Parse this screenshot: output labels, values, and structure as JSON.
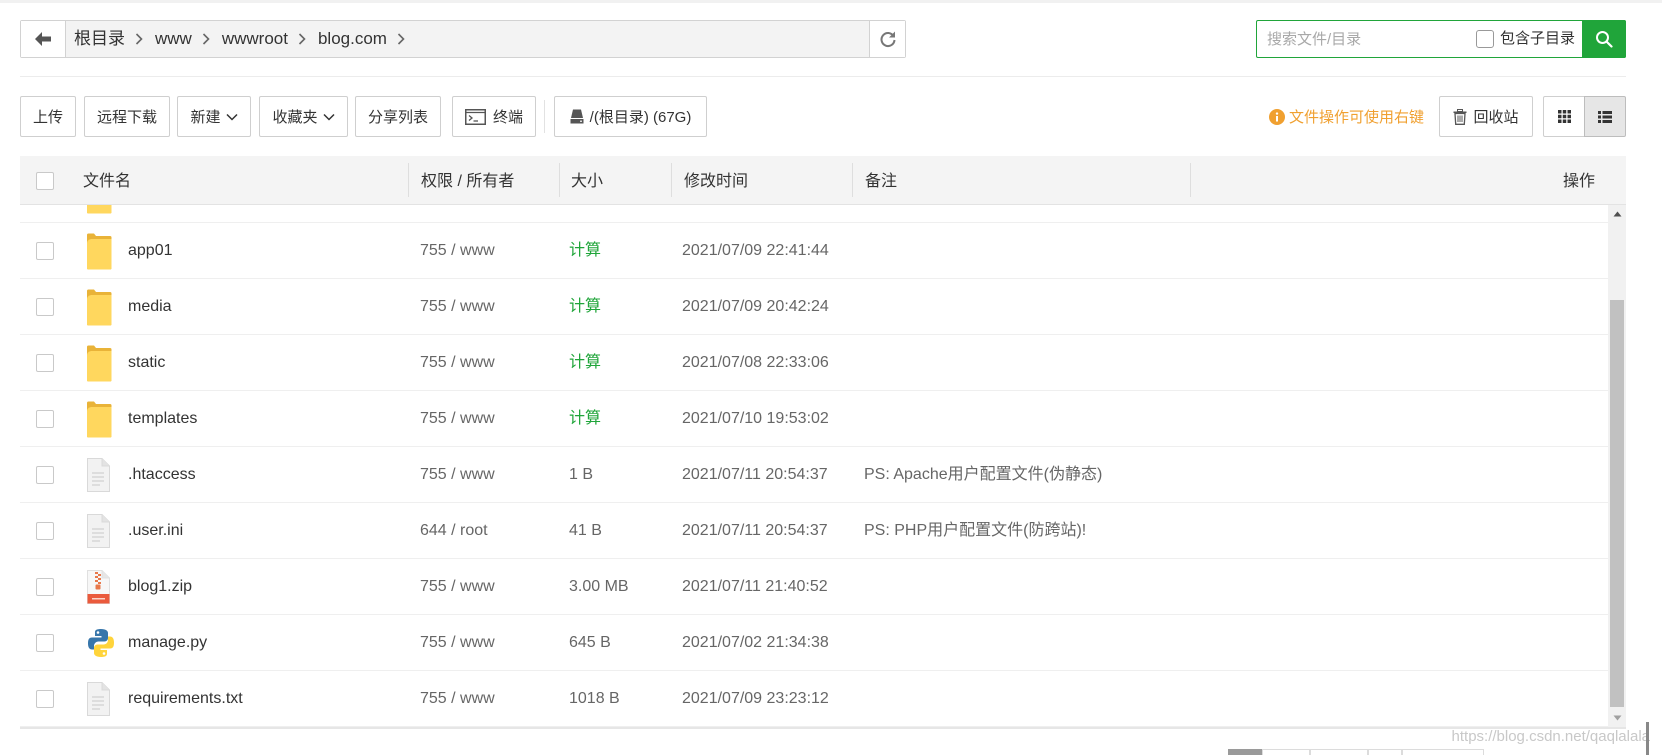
{
  "breadcrumb": {
    "items": [
      "根目录",
      "www",
      "wwwroot",
      "blog.com"
    ]
  },
  "search": {
    "placeholder": "搜索文件/目录",
    "include_subdir": "包含子目录"
  },
  "toolbar": {
    "upload": "上传",
    "remote_download": "远程下载",
    "new": "新建",
    "favorites": "收藏夹",
    "share_list": "分享列表",
    "terminal": "终端",
    "disk": "/(根目录) (67G)",
    "hint": "文件操作可使用右键",
    "recycle_bin": "回收站"
  },
  "table": {
    "headers": {
      "name": "文件名",
      "perm": "权限 / 所有者",
      "size": "大小",
      "mtime": "修改时间",
      "note": "备注",
      "actions": "操作"
    },
    "rows": [
      {
        "icon": "folder-icon",
        "name": "app01",
        "perm": "755 / www",
        "size": "计算",
        "mtime": "2021/07/09 22:41:44"
      },
      {
        "icon": "folder-icon",
        "name": "media",
        "perm": "755 / www",
        "size": "计算",
        "mtime": "2021/07/09 20:42:24"
      },
      {
        "icon": "folder-icon",
        "name": "static",
        "perm": "755 / www",
        "size": "计算",
        "mtime": "2021/07/08 22:33:06"
      },
      {
        "icon": "folder-icon",
        "name": "templates",
        "perm": "755 / www",
        "size": "计算",
        "mtime": "2021/07/10 19:53:02"
      },
      {
        "icon": "file-icon",
        "name": ".htaccess",
        "perm": "755 / www",
        "size": "1 B",
        "mtime": "2021/07/11 20:54:37",
        "note": "PS: Apache用户配置文件(伪静态)"
      },
      {
        "icon": "file-icon",
        "name": ".user.ini",
        "perm": "644 / root",
        "size": "41 B",
        "mtime": "2021/07/11 20:54:37",
        "note": "PS: PHP用户配置文件(防跨站)!"
      },
      {
        "icon": "zip-icon",
        "name": "blog1.zip",
        "perm": "755 / www",
        "size": "3.00 MB",
        "mtime": "2021/07/11 21:40:52"
      },
      {
        "icon": "python-icon",
        "name": "manage.py",
        "perm": "755 / www",
        "size": "645 B",
        "mtime": "2021/07/02 21:34:38"
      },
      {
        "icon": "file-icon",
        "name": "requirements.txt",
        "perm": "755 / www",
        "size": "1018 B",
        "mtime": "2021/07/09 23:23:12"
      }
    ]
  },
  "watermark": "https://blog.csdn.net/qaqlalala",
  "colors": {
    "accent": "#20a53a",
    "hint": "#f0a030",
    "text": "#333333"
  }
}
